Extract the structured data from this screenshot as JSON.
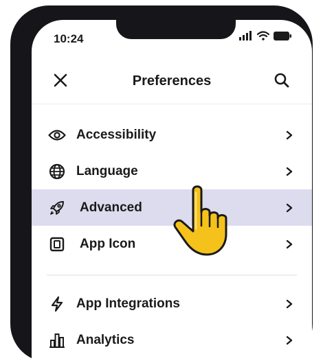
{
  "status_bar": {
    "time": "10:24"
  },
  "header": {
    "title": "Preferences"
  },
  "menu": {
    "section_1": [
      {
        "label": "Accessibility",
        "icon": "eye-icon"
      },
      {
        "label": "Language",
        "icon": "globe-icon"
      },
      {
        "label": "Advanced",
        "icon": "rocket-icon",
        "selected": true
      },
      {
        "label": "App Icon",
        "icon": "app-icon-icon"
      }
    ],
    "section_2": [
      {
        "label": "App Integrations",
        "icon": "lightning-icon"
      },
      {
        "label": "Analytics",
        "icon": "bar-chart-icon"
      }
    ]
  },
  "colors": {
    "phone_frame": "#16161a",
    "selected_row": "#dcdcee",
    "pointer_hand": "#f4c21b"
  }
}
